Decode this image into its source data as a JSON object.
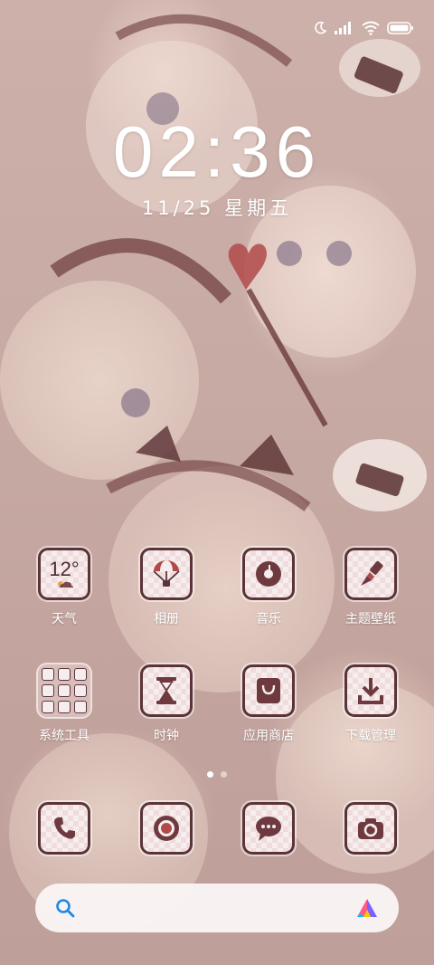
{
  "status_bar": {
    "icons": [
      "moon-icon",
      "signal-icon",
      "wifi-icon",
      "battery-icon"
    ]
  },
  "lock_clock": {
    "time": "02:36",
    "date": "11/25 星期五"
  },
  "home_grid": {
    "row1": [
      {
        "label": "天气",
        "icon": "weather-icon",
        "temp": "12°"
      },
      {
        "label": "相册",
        "icon": "gallery-icon"
      },
      {
        "label": "音乐",
        "icon": "music-icon"
      },
      {
        "label": "主题壁纸",
        "icon": "brush-icon"
      }
    ],
    "row2": [
      {
        "label": "系统工具",
        "icon": "folder-icon"
      },
      {
        "label": "时钟",
        "icon": "hourglass-icon"
      },
      {
        "label": "应用商店",
        "icon": "store-icon"
      },
      {
        "label": "下载管理",
        "icon": "download-icon"
      }
    ]
  },
  "page_indicator": {
    "pages": 2,
    "current": 1
  },
  "dock": [
    {
      "icon": "phone-icon"
    },
    {
      "icon": "browser-icon"
    },
    {
      "icon": "message-icon"
    },
    {
      "icon": "camera-icon"
    }
  ],
  "search_bar": {
    "icons": [
      "search-icon",
      "assistant-icon"
    ]
  },
  "colors": {
    "icon_stroke": "#5b3438",
    "icon_fill": "#f6eeee",
    "search_accent": "#1e88e5"
  }
}
